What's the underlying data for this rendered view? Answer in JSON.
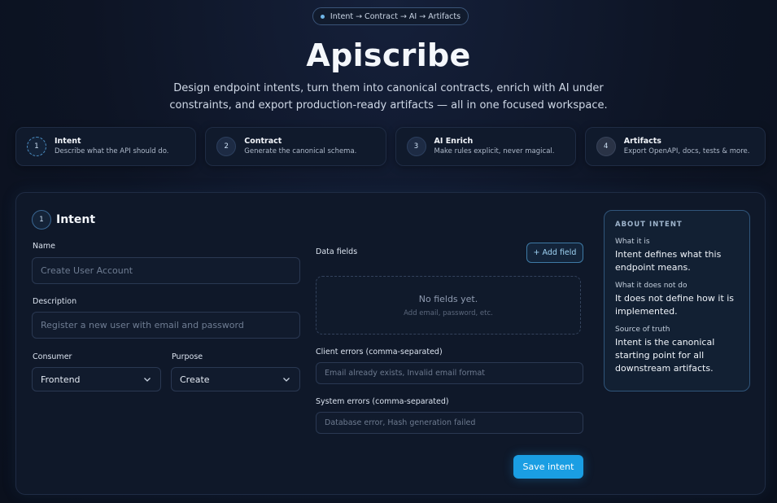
{
  "header": {
    "pill_text": "Intent → Contract → AI → Artifacts",
    "title": "Apiscribe",
    "subtitle": "Design endpoint intents, turn them into canonical contracts, enrich with AI under constraints, and export production-ready artifacts — all in one focused workspace."
  },
  "steps": [
    {
      "num": "1",
      "title": "Intent",
      "desc": "Describe what the API should do."
    },
    {
      "num": "2",
      "title": "Contract",
      "desc": "Generate the canonical schema."
    },
    {
      "num": "3",
      "title": "AI Enrich",
      "desc": "Make rules explicit, never magical."
    },
    {
      "num": "4",
      "title": "Artifacts",
      "desc": "Export OpenAPI, docs, tests & more."
    }
  ],
  "form": {
    "num": "1",
    "title": "Intent",
    "name_label": "Name",
    "name_placeholder": "Create User Account",
    "description_label": "Description",
    "description_placeholder": "Register a new user with email and password",
    "consumer_label": "Consumer",
    "consumer_value": "Frontend",
    "purpose_label": "Purpose",
    "purpose_value": "Create",
    "data_fields_label": "Data fields",
    "add_field_label": "+ Add field",
    "empty_title": "No fields yet.",
    "empty_sub": "Add email, password, etc.",
    "client_errors_label": "Client errors (comma-separated)",
    "client_errors_placeholder": "Email already exists, Invalid email format",
    "system_errors_label": "System errors (comma-separated)",
    "system_errors_placeholder": "Database error, Hash generation failed",
    "save_label": "Save intent"
  },
  "about": {
    "heading": "ABOUT INTENT",
    "items": [
      {
        "q": "What it is",
        "a": "Intent defines what this endpoint means."
      },
      {
        "q": "What it does not do",
        "a": "It does not define how it is implemented."
      },
      {
        "q": "Source of truth",
        "a": "Intent is the canonical starting point for all downstream artifacts."
      }
    ]
  },
  "icons": {
    "consumer_select": "chevron-down-icon",
    "purpose_select": "chevron-down-icon",
    "pill_dot": "dot-icon"
  },
  "colors": {
    "accent": "#1a9ee3",
    "background": "#0c1322",
    "accent_border": "#3e7aa5"
  }
}
